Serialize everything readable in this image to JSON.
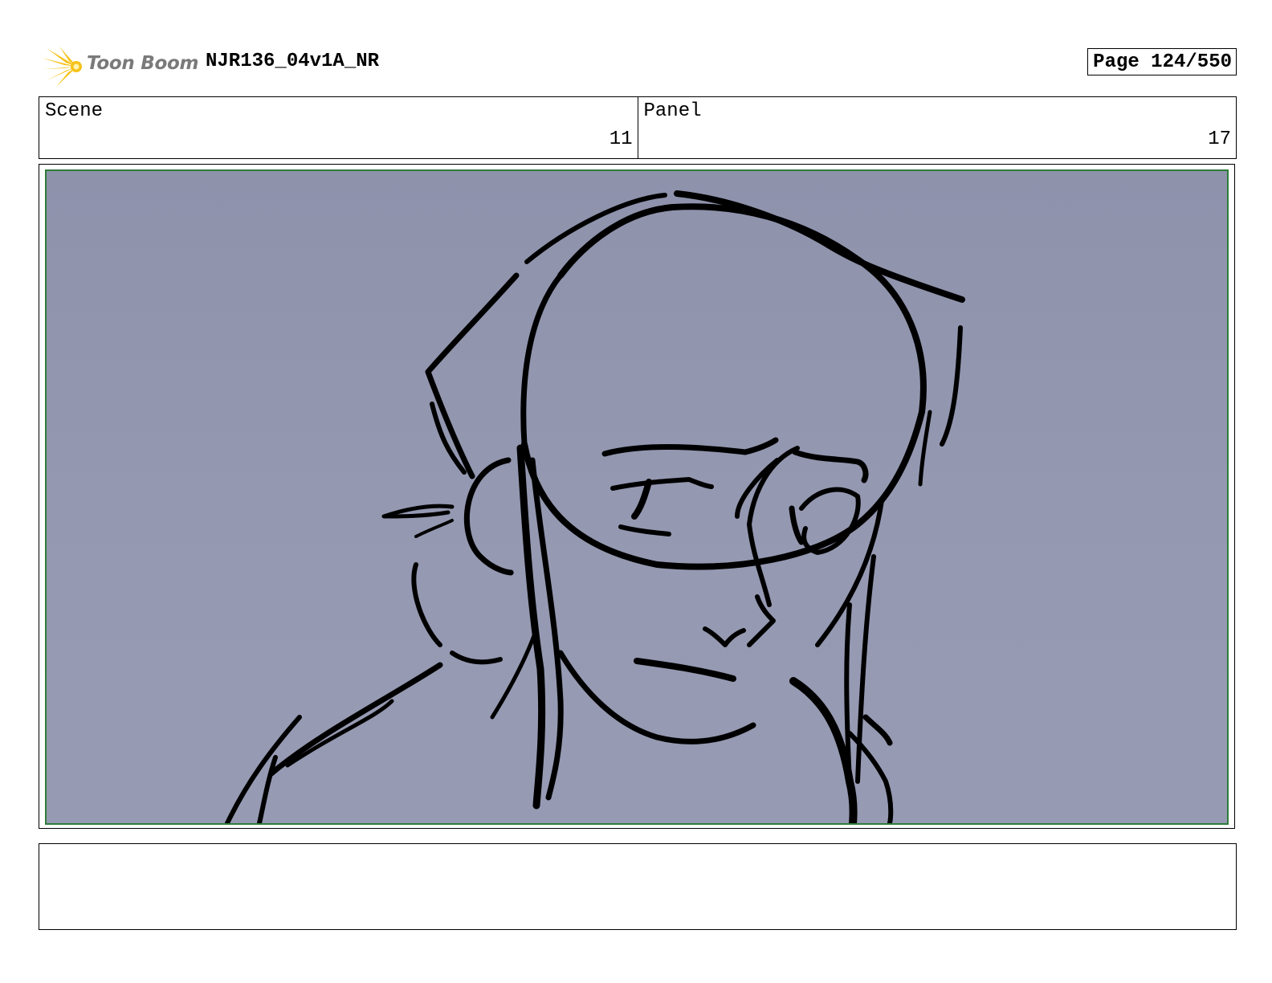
{
  "header": {
    "logo_text": "Toon Boom",
    "document_title": "NJR136_04v1A_NR",
    "page_label": "Page 124/550"
  },
  "info": {
    "scene_label": "Scene",
    "scene_value": "11",
    "panel_label": "Panel",
    "panel_value": "17"
  },
  "panel_image": {
    "subject": "rough sketch of a girl with hair bun and headband",
    "background_color": "#9195ae",
    "frame_border_color": "#2e7d3a"
  },
  "colors": {
    "logo_yellow": "#f6c21a",
    "logo_text": "#7a7a7a"
  }
}
